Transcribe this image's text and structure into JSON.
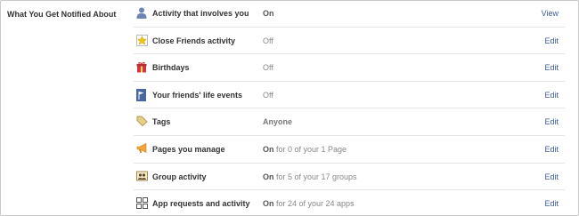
{
  "section_label": "What You Get Notified About",
  "rows": [
    {
      "name": "Activity that involves you",
      "status_bold": "On",
      "status_rest": "",
      "action": "View",
      "icon": "person-icon"
    },
    {
      "name": "Close Friends activity",
      "status_bold": "",
      "status_rest": "Off",
      "action": "Edit",
      "icon": "star-icon"
    },
    {
      "name": "Birthdays",
      "status_bold": "",
      "status_rest": "Off",
      "action": "Edit",
      "icon": "gift-icon"
    },
    {
      "name": "Your friends' life events",
      "status_bold": "",
      "status_rest": "Off",
      "action": "Edit",
      "icon": "flag-icon"
    },
    {
      "name": "Tags",
      "status_bold": "Anyone",
      "status_rest": "",
      "action": "Edit",
      "icon": "tag-icon"
    },
    {
      "name": "Pages you manage",
      "status_bold": "On",
      "status_rest": " for 0 of your 1 Page",
      "action": "Edit",
      "icon": "megaphone-icon"
    },
    {
      "name": "Group activity",
      "status_bold": "On",
      "status_rest": " for 5 of your 17 groups",
      "action": "Edit",
      "icon": "group-icon"
    },
    {
      "name": "App requests and activity",
      "status_bold": "On",
      "status_rest": " for 24 of your 24 apps",
      "action": "Edit",
      "icon": "apps-icon"
    }
  ],
  "colors": {
    "link": "#3b5998",
    "divider": "#e5e5e5"
  }
}
